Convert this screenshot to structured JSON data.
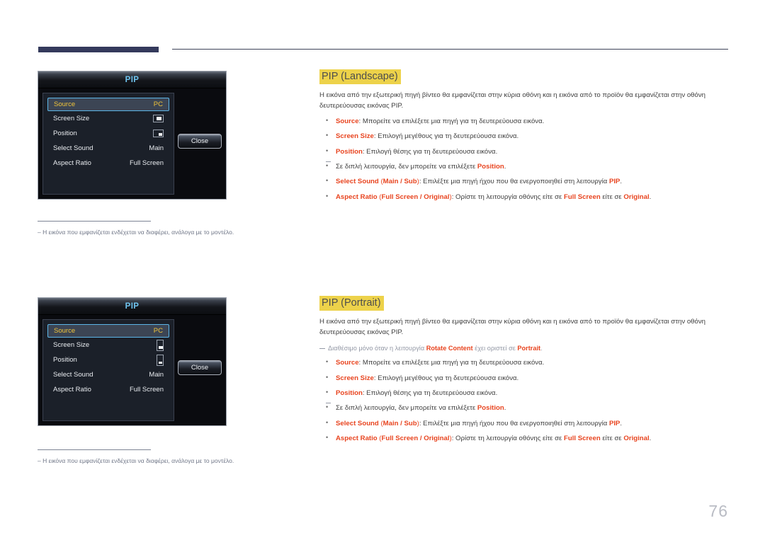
{
  "page": {
    "number": "76"
  },
  "header": {
    "bar_color": "#343a5c",
    "rule_color": "#3d4358"
  },
  "osd_landscape": {
    "title": "PIP",
    "rows": [
      {
        "label": "Source",
        "value": "PC",
        "type": "text",
        "selected": true
      },
      {
        "label": "Screen Size",
        "value": "",
        "type": "icon-screen-size",
        "selected": false
      },
      {
        "label": "Position",
        "value": "",
        "type": "icon-position",
        "selected": false
      },
      {
        "label": "Select Sound",
        "value": "Main",
        "type": "text",
        "selected": false
      },
      {
        "label": "Aspect Ratio",
        "value": "Full Screen",
        "type": "text",
        "selected": false
      }
    ],
    "close_label": "Close",
    "footnote": "Η εικόνα που εμφανίζεται ενδέχεται να διαφέρει, ανάλογα με το μοντέλο."
  },
  "osd_portrait": {
    "title": "PIP",
    "rows": [
      {
        "label": "Source",
        "value": "PC",
        "type": "text",
        "selected": true
      },
      {
        "label": "Screen Size",
        "value": "",
        "type": "icon-screen-size",
        "selected": false
      },
      {
        "label": "Position",
        "value": "",
        "type": "icon-position",
        "selected": false
      },
      {
        "label": "Select Sound",
        "value": "Main",
        "type": "text",
        "selected": false
      },
      {
        "label": "Aspect Ratio",
        "value": "Full Screen",
        "type": "text",
        "selected": false
      }
    ],
    "close_label": "Close",
    "footnote": "Η εικόνα που εμφανίζεται ενδέχεται να διαφέρει, ανάλογα με το μοντέλο."
  },
  "section_landscape": {
    "heading": "PIP (Landscape)",
    "intro": "Η εικόνα από την εξωτερική πηγή βίντεο θα εμφανίζεται στην κύρια οθόνη και η εικόνα από το προϊόν θα εμφανίζεται στην οθόνη δευτερεύουσας εικόνας PIP.",
    "bullets": [
      {
        "term": "Source",
        "rest": ": Μπορείτε να επιλέξετε μια πηγή για τη δευτερεύουσα εικόνα."
      },
      {
        "term": "Screen Size",
        "rest": ": Επιλογή μεγέθους για τη δευτερεύουσα εικόνα."
      },
      {
        "term": "Position",
        "rest": ": Επιλογή θέσης για τη δευτερεύουσα εικόνα."
      }
    ],
    "position_note_pre": "Σε διπλή λειτουργία, δεν μπορείτε να επιλέξετε ",
    "position_note_term": "Position",
    "position_note_post": ".",
    "select_sound": {
      "term": "Select Sound",
      "opt_open": " (",
      "opt_main": "Main",
      "opt_sep": " / ",
      "opt_sub": "Sub",
      "opt_close": ")",
      "mid": ": Επιλέξτε μια πηγή ήχου που θα ενεργοποιηθεί στη λειτουργία ",
      "pip": "PIP",
      "end": "."
    },
    "aspect_ratio": {
      "term": "Aspect Ratio",
      "opt_open": " (",
      "opt_full": "Full Screen",
      "opt_sep": " / ",
      "opt_orig": "Original",
      "opt_close": ")",
      "mid": ": Ορίστε τη λειτουργία οθόνης είτε σε ",
      "full": "Full Screen",
      "mid2": " είτε σε ",
      "orig": "Original",
      "end": "."
    }
  },
  "section_portrait": {
    "heading": "PIP (Portrait)",
    "intro": "Η εικόνα από την εξωτερική πηγή βίντεο θα εμφανίζεται στην κύρια οθόνη και η εικόνα από το προϊόν θα εμφανίζεται στην οθόνη δευτερεύουσας εικόνας PIP.",
    "avail_note_pre": "Διαθέσιμο μόνο όταν η λειτουργία ",
    "avail_note_term": "Rotate Content",
    "avail_note_mid": " έχει οριστεί σε ",
    "avail_note_term2": "Portrait",
    "avail_note_post": ".",
    "bullets": [
      {
        "term": "Source",
        "rest": ": Μπορείτε να επιλέξετε μια πηγή για τη δευτερεύουσα εικόνα."
      },
      {
        "term": "Screen Size",
        "rest": ": Επιλογή μεγέθους για τη δευτερεύουσα εικόνα."
      },
      {
        "term": "Position",
        "rest": ": Επιλογή θέσης για τη δευτερεύουσα εικόνα."
      }
    ],
    "position_note_pre": "Σε διπλή λειτουργία, δεν μπορείτε να επιλέξετε ",
    "position_note_term": "Position",
    "position_note_post": ".",
    "select_sound": {
      "term": "Select Sound",
      "opt_open": " (",
      "opt_main": "Main",
      "opt_sep": " / ",
      "opt_sub": "Sub",
      "opt_close": ")",
      "mid": ": Επιλέξτε μια πηγή ήχου που θα ενεργοποιηθεί στη λειτουργία ",
      "pip": "PIP",
      "end": "."
    },
    "aspect_ratio": {
      "term": "Aspect Ratio",
      "opt_open": " (",
      "opt_full": "Full Screen",
      "opt_sep": " / ",
      "opt_orig": "Original",
      "opt_close": ")",
      "mid": ": Ορίστε τη λειτουργία οθόνης είτε σε ",
      "full": "Full Screen",
      "mid2": " είτε σε ",
      "orig": "Original",
      "end": "."
    }
  }
}
